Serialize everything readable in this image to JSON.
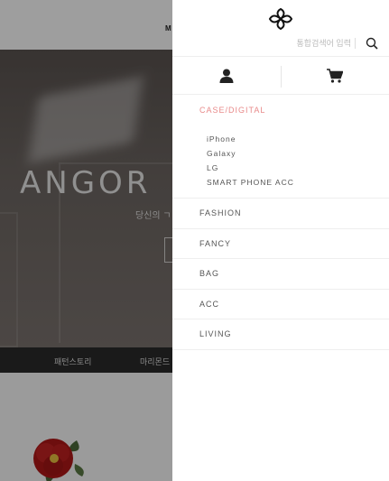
{
  "background": {
    "header_text": "M",
    "hero_title": "ANGOR",
    "hero_subtitle": "당신의 ㄱ",
    "nav_items": [
      "패턴스토리",
      "마리몬드"
    ]
  },
  "drawer": {
    "logo_icon": "lattice-logo-icon",
    "search": {
      "placeholder": "통합검색어 입력",
      "icon": "search-icon"
    },
    "icons": {
      "account": "user-icon",
      "cart": "cart-icon"
    },
    "active_category": {
      "label": "CASE/DIGITAL",
      "subcategories": [
        "iPhone",
        "Galaxy",
        "LG",
        "SMART PHONE ACC"
      ]
    },
    "categories": [
      "FASHION",
      "FANCY",
      "BAG",
      "ACC",
      "LIVING"
    ]
  },
  "colors": {
    "active_category": "#e88a8a",
    "overlay": "rgba(0,0,0,0.38)"
  }
}
